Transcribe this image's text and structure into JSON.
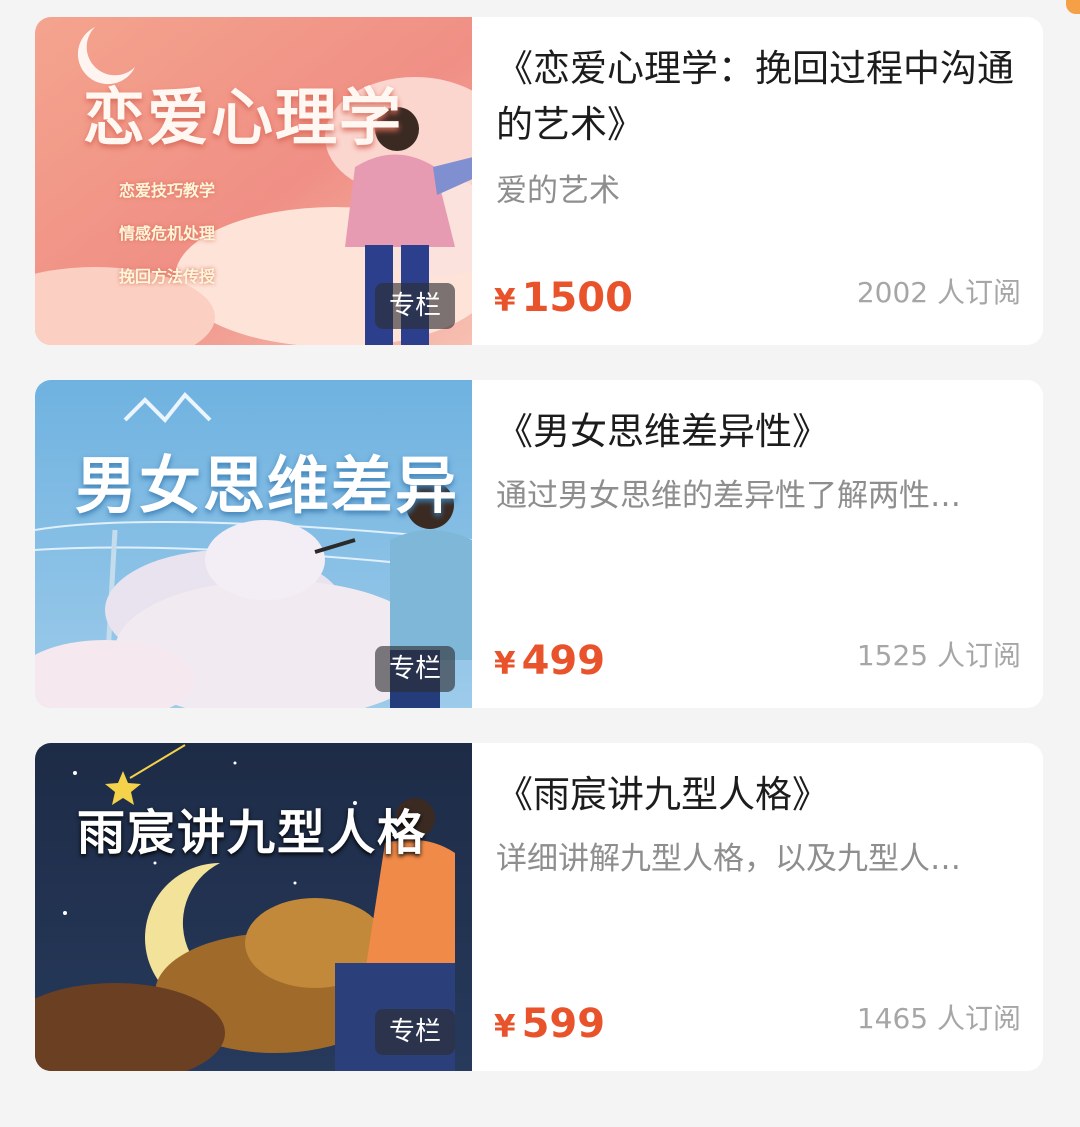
{
  "courses": [
    {
      "thumb_title": "恋爱心理学",
      "thumb_lines": [
        "恋爱技巧教学",
        "情感危机处理",
        "挽回方法传授"
      ],
      "badge": "专栏",
      "title": "《恋爱心理学：挽回过程中沟通的艺术》",
      "subtitle": "爱的艺术",
      "currency": "¥",
      "price": "1500",
      "subscribers": "2002 人订阅"
    },
    {
      "thumb_title": "男女思维差异",
      "badge": "专栏",
      "title": "《男女思维差异性》",
      "subtitle": "通过男女思维的差异性了解两性…",
      "currency": "¥",
      "price": "499",
      "subscribers": "1525 人订阅"
    },
    {
      "thumb_title": "雨宸讲九型人格",
      "badge": "专栏",
      "title": "《雨宸讲九型人格》",
      "subtitle": "详细讲解九型人格，以及九型人…",
      "currency": "¥",
      "price": "599",
      "subscribers": "1465 人订阅"
    }
  ],
  "colors": {
    "price": "#e8532b",
    "accent_corner": "#f5a046"
  }
}
